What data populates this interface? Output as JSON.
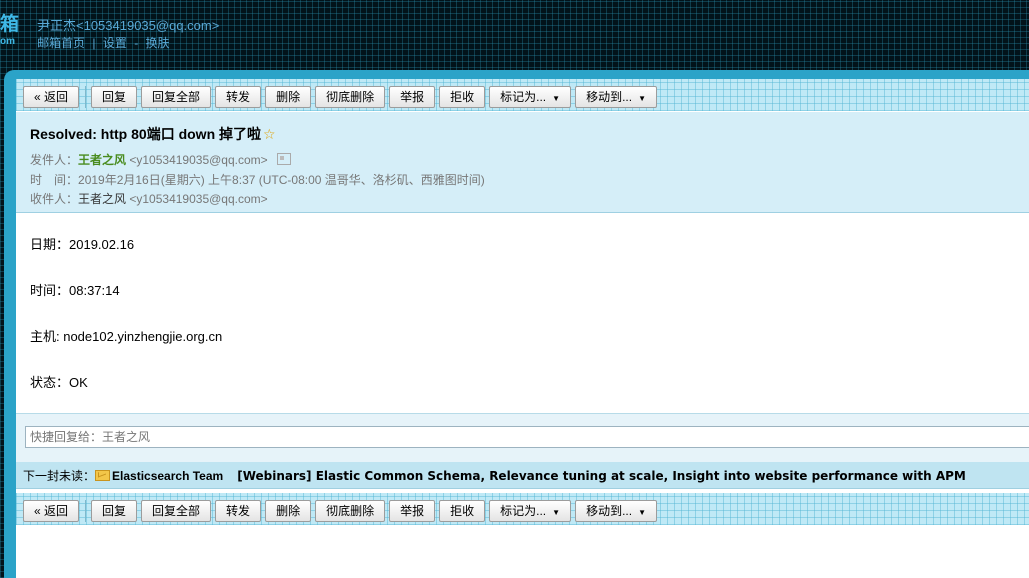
{
  "header": {
    "logo_big": "箱",
    "logo_small": "om",
    "user": "尹正杰<1053419035@qq.com>",
    "nav": {
      "home": "邮箱首页",
      "separator": "|",
      "settings": "设置",
      "dash": "-",
      "skin": "换肤"
    }
  },
  "toolbar": {
    "back": "« 返回",
    "reply": "回复",
    "reply_all": "回复全部",
    "forward": "转发",
    "delete": "删除",
    "delete_permanent": "彻底删除",
    "report": "举报",
    "reject": "拒收",
    "mark_as": "标记为...",
    "move_to": "移动到...",
    "dropdown_arrow": "▼"
  },
  "message": {
    "subject": "Resolved: http 80端口 down 掉了啦",
    "star": "☆",
    "from_label": "发件人：",
    "from_name": "王者之风",
    "from_addr": "<y1053419035@qq.com>",
    "time_label": "时　间：",
    "time_value": "2019年2月16日(星期六) 上午8:37 (UTC-08:00 温哥华、洛杉矶、西雅图时间)",
    "to_label": "收件人：",
    "to_name": "王者之风",
    "to_addr": "<y1053419035@qq.com>",
    "body": [
      "日期：2019.02.16",
      "时间：08:37:14",
      "主机: node102.yinzhengjie.org.cn",
      "状态：OK"
    ]
  },
  "quick_reply": {
    "placeholder": "快捷回复给：王者之风"
  },
  "next_mail": {
    "label": "下一封未读：",
    "sender": "Elasticsearch Team",
    "subject": "[Webinars] Elastic Common Schema, Relevance tuning at scale, Insight into website performance with APM"
  },
  "colors": {
    "frame": "#2ba3c8",
    "header_bg": "#d5eef8",
    "sender_green": "#4a8c1f",
    "nav_blue": "#5aa9d6"
  }
}
